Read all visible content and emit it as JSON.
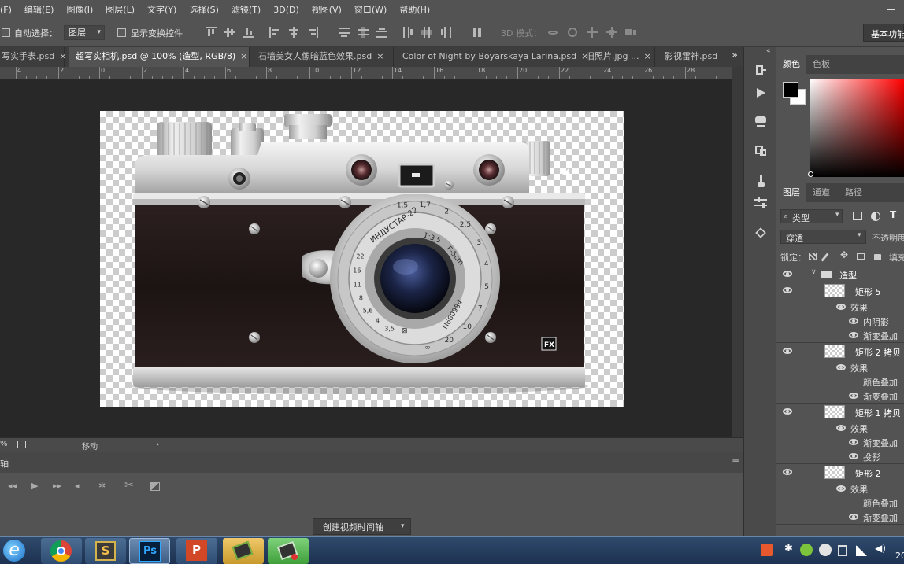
{
  "menu": {
    "items": [
      "(F)",
      "编辑(E)",
      "图像(I)",
      "图层(L)",
      "文字(Y)",
      "选择(S)",
      "滤镜(T)",
      "3D(D)",
      "视图(V)",
      "窗口(W)",
      "帮助(H)"
    ]
  },
  "options": {
    "auto_select_label": "自动选择：",
    "auto_select_value": "图层",
    "show_transform_label": "显示变换控件",
    "mode_3d_label": "3D 模式：",
    "workspace_label": "基本功能"
  },
  "tabs": [
    {
      "label": "写实手表.psd",
      "active": false
    },
    {
      "label": "超写实相机.psd @ 100% (造型, RGB/8)",
      "active": true
    },
    {
      "label": "石墙美女人像暗蓝色效果.psd",
      "active": false
    },
    {
      "label": "Color of Night by Boyarskaya Larina.psd",
      "active": false
    },
    {
      "label": "旧照片.jpg ...",
      "active": false
    },
    {
      "label": "影视雷神.psd",
      "active": false
    }
  ],
  "tab_close": "×",
  "tabs_overflow": "»",
  "ruler": {
    "ticks": [
      "4",
      "2",
      "0",
      "2",
      "4",
      "6",
      "8",
      "10",
      "12",
      "14",
      "16",
      "18",
      "20",
      "22",
      "24",
      "26",
      "28"
    ]
  },
  "statusbar": {
    "zoom_suffix": "%",
    "mode_text": "移动",
    "arrow": "›"
  },
  "timeline": {
    "title": "轴",
    "create_button": "创建视频时间轴",
    "menu_icon": "≡"
  },
  "camera": {
    "lens_text": "ИНДУСТАР-22",
    "aperture_text": "1:3,5",
    "focal_text": "F-5cm",
    "serial_text": "N660984",
    "scale_numbers": [
      "1,5",
      "1,7",
      "2",
      "2,5",
      "3",
      "4",
      "5",
      "7",
      "10",
      "20",
      "∞"
    ],
    "depth_numbers": [
      "22",
      "16",
      "11",
      "8",
      "5,6",
      "4",
      "3,5"
    ],
    "fx_badge": "FX"
  },
  "right_panel": {
    "color_tab": "颜色",
    "swatch_tab": "色板",
    "layers_tab": "图层",
    "channels_tab": "通道",
    "paths_tab": "路径",
    "kind_filter": "类型",
    "blend_mode": "穿透",
    "opacity_label": "不透明度",
    "lock_label": "锁定：",
    "fill_label": "填充",
    "layers": [
      {
        "name": "造型",
        "type": "group",
        "indent": 0
      },
      {
        "name": "矩形 5",
        "type": "layer",
        "indent": 1
      },
      {
        "name": "效果",
        "type": "fx-head",
        "indent": 2
      },
      {
        "name": "内阴影",
        "type": "fx",
        "indent": 3
      },
      {
        "name": "渐变叠加",
        "type": "fx",
        "indent": 3
      },
      {
        "name": "矩形 2 拷贝",
        "type": "layer",
        "indent": 1
      },
      {
        "name": "效果",
        "type": "fx-head",
        "indent": 2
      },
      {
        "name": "颜色叠加",
        "type": "fx",
        "indent": 3
      },
      {
        "name": "渐变叠加",
        "type": "fx",
        "indent": 3
      },
      {
        "name": "矩形 1 拷贝",
        "type": "layer",
        "indent": 1
      },
      {
        "name": "效果",
        "type": "fx-head",
        "indent": 2
      },
      {
        "name": "渐变叠加",
        "type": "fx",
        "indent": 3
      },
      {
        "name": "投影",
        "type": "fx",
        "indent": 3
      },
      {
        "name": "矩形 2",
        "type": "layer",
        "indent": 1
      },
      {
        "name": "效果",
        "type": "fx-head",
        "indent": 2
      },
      {
        "name": "颜色叠加",
        "type": "fx",
        "indent": 3
      },
      {
        "name": "渐变叠加",
        "type": "fx",
        "indent": 3
      }
    ]
  },
  "taskbar": {
    "clock": "20"
  },
  "colors": {
    "ui_bg": "#535353",
    "canvas_bg": "#282828",
    "accent_hue": "#ff0000"
  }
}
